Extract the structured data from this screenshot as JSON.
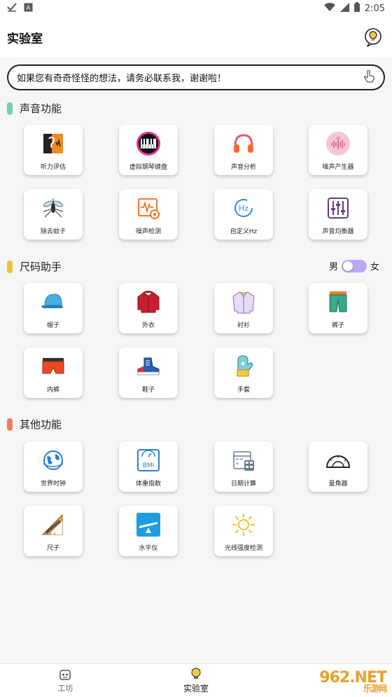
{
  "statusbar": {
    "time": "2:05"
  },
  "appbar": {
    "title": "实验室"
  },
  "notice": {
    "text": "如果您有奇奇怪怪的想法，请务必联系我，谢谢啦！"
  },
  "sections": {
    "sound": {
      "title": "声音功能",
      "color": "#6fd1b0",
      "items": [
        "听力评估",
        "虚拟钢琴键盘",
        "声音分析",
        "噪声产生器",
        "除去蚊子",
        "噪声检测",
        "自定义Hz",
        "声音均衡器"
      ]
    },
    "size": {
      "title": "尺码助手",
      "color": "#e8c43a",
      "toggle_left": "男",
      "toggle_right": "女",
      "items": [
        "帽子",
        "外衣",
        "衬衫",
        "裤子",
        "内裤",
        "鞋子",
        "手套"
      ]
    },
    "other": {
      "title": "其他功能",
      "color": "#f27a5e",
      "items": [
        "世界时钟",
        "体重指数",
        "日期计算",
        "量角器",
        "尺子",
        "水平仪",
        "光线强度检测"
      ]
    }
  },
  "icons": {
    "hz_text": "Hz",
    "bmi_text": "BMI"
  },
  "bottom_nav": [
    {
      "label": "工坊"
    },
    {
      "label": "实验室"
    }
  ],
  "watermark": {
    "brand": "962.NET",
    "sub": "乐游网"
  }
}
